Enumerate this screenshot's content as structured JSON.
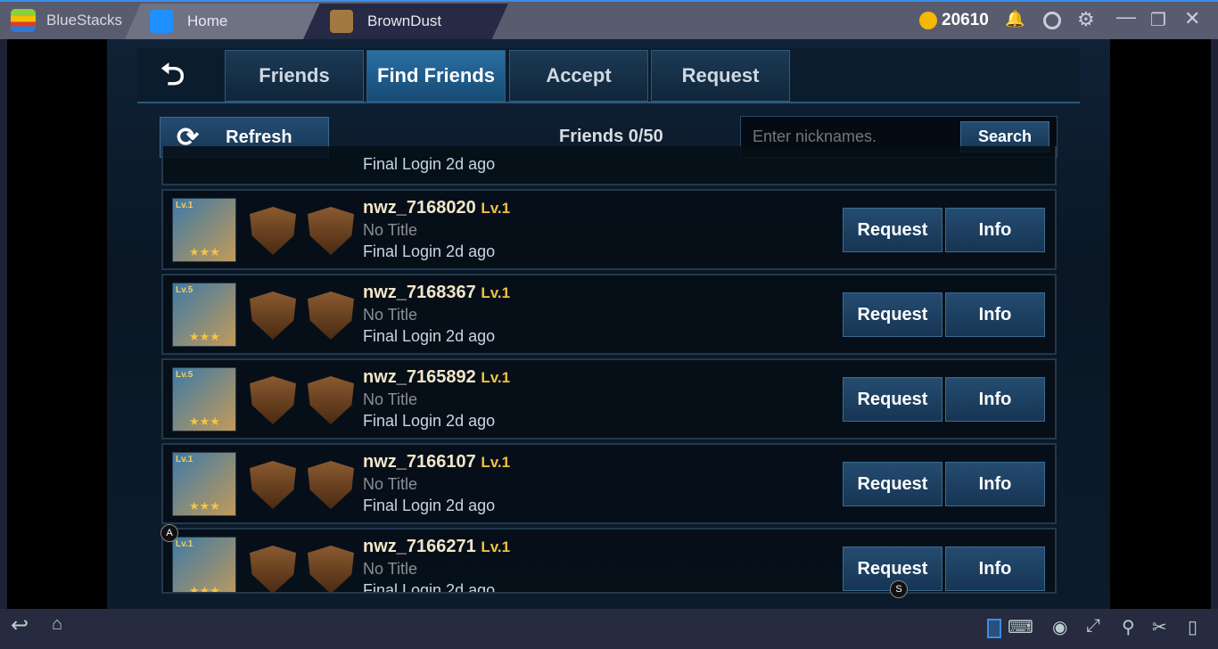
{
  "titlebar": {
    "app": "BlueStacks",
    "tabs": [
      {
        "label": "Home"
      },
      {
        "label": "BrownDust"
      }
    ],
    "coins": "20610"
  },
  "game": {
    "tabs": [
      {
        "label": "Friends"
      },
      {
        "label": "Find Friends",
        "active": true
      },
      {
        "label": "Accept"
      },
      {
        "label": "Request"
      }
    ],
    "refresh_label": "Refresh",
    "friends_count": "Friends 0/50",
    "search_placeholder": "Enter nicknames.",
    "search_label": "Search",
    "partial_row_login": "Final Login 2d ago",
    "rows": [
      {
        "name": "nwz_7168020",
        "level": "Lv.1",
        "title": "No Title",
        "login": "Final Login 2d ago",
        "avatar_level": "Lv.1"
      },
      {
        "name": "nwz_7168367",
        "level": "Lv.1",
        "title": "No Title",
        "login": "Final Login 2d ago",
        "avatar_level": "Lv.5"
      },
      {
        "name": "nwz_7165892",
        "level": "Lv.1",
        "title": "No Title",
        "login": "Final Login 2d ago",
        "avatar_level": "Lv.5"
      },
      {
        "name": "nwz_7166107",
        "level": "Lv.1",
        "title": "No Title",
        "login": "Final Login 2d ago",
        "avatar_level": "Lv.1"
      },
      {
        "name": "nwz_7166271",
        "level": "Lv.1",
        "title": "No Title",
        "login": "Final Login 2d ago",
        "avatar_level": "Lv.1"
      }
    ],
    "request_label": "Request",
    "info_label": "Info",
    "key_a": "A",
    "key_s": "S"
  }
}
